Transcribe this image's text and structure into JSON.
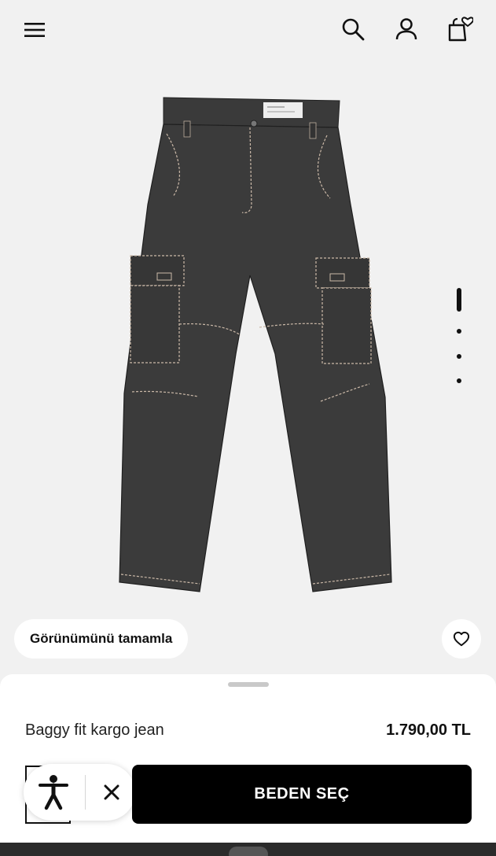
{
  "header": {
    "menu_icon": "hamburger-menu-icon",
    "search_icon": "search-icon",
    "account_icon": "user-icon",
    "bag_icon": "shopping-bag-heart-icon"
  },
  "gallery": {
    "image_label": "baggy-fit-cargo-jean-image",
    "image_count": 4,
    "active_index": 1
  },
  "actions": {
    "complete_look_label": "Görünümünü tamamla",
    "wishlist_icon": "heart-icon"
  },
  "sheet": {
    "product_name": "Baggy fit kargo jean",
    "price": "1.790,00 TL",
    "cta_label": "BEDEN SEÇ",
    "accessibility_icon": "accessibility-person-icon",
    "close_icon": "close-icon"
  },
  "colors": {
    "background": "#f1f1f1",
    "cta_background": "#000000",
    "cta_text": "#ffffff",
    "denim": "#3b3b3b"
  }
}
